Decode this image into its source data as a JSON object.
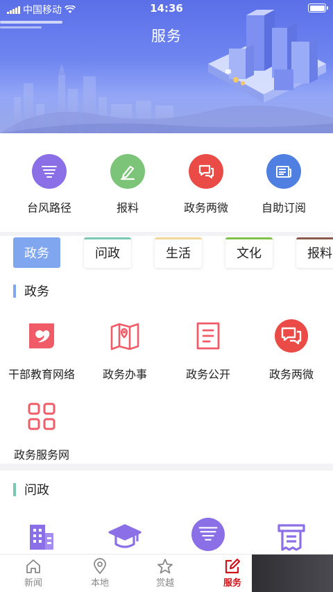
{
  "status_bar": {
    "carrier": "中国移动",
    "time": "14:36"
  },
  "header": {
    "title": "服务"
  },
  "quick_tools": [
    {
      "label": "台风路径",
      "icon": "typhoon-icon",
      "color": "#8b6fe6"
    },
    {
      "label": "报料",
      "icon": "pencil-icon",
      "color": "#7cc477"
    },
    {
      "label": "政务两微",
      "icon": "chat-bubbles-icon",
      "color": "#ea4b46"
    },
    {
      "label": "自助订阅",
      "icon": "newspaper-icon",
      "color": "#4f7fe0"
    }
  ],
  "tabs": [
    {
      "label": "政务",
      "active": true,
      "accent": "#7fa6ef"
    },
    {
      "label": "问政",
      "accent": "#7ac7b3"
    },
    {
      "label": "生活",
      "accent": "#f1d79a"
    },
    {
      "label": "文化",
      "accent": "#82c24a"
    },
    {
      "label": "报料",
      "accent": "#8b5a4e"
    }
  ],
  "section_gov": {
    "title": "政务",
    "accent": "#7fa6ef",
    "items": [
      {
        "label": "干部教育网络",
        "icon": "education-heart-icon"
      },
      {
        "label": "政务办事",
        "icon": "map-pin-icon"
      },
      {
        "label": "政务公开",
        "icon": "document-icon"
      },
      {
        "label": "政务两微",
        "icon": "chat-bubbles-icon"
      },
      {
        "label": "政务服务网",
        "icon": "grid-apps-icon"
      }
    ]
  },
  "section_inquiry": {
    "title": "问政",
    "accent": "#7ac7b3",
    "items": [
      {
        "icon": "building-icon"
      },
      {
        "icon": "graduation-cap-icon"
      },
      {
        "icon": "typhoon-icon"
      },
      {
        "icon": "ticket-printer-icon"
      }
    ]
  },
  "bottom_nav": [
    {
      "label": "新闻",
      "icon": "home-icon"
    },
    {
      "label": "本地",
      "icon": "location-pin-icon"
    },
    {
      "label": "赏越",
      "icon": "star-icon"
    },
    {
      "label": "服务",
      "icon": "edit-square-icon",
      "active": true
    }
  ]
}
